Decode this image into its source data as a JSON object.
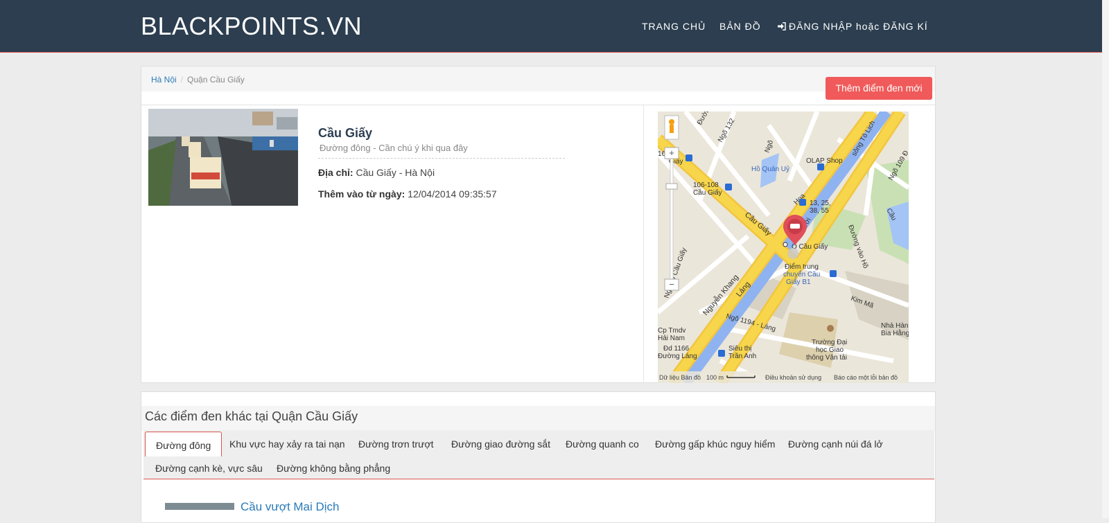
{
  "nav": {
    "brand": "BLACKPOINTS.VN",
    "home": "TRANG CHỦ",
    "map": "BẢN ĐỒ",
    "login": "ĐĂNG NHẬP hoặc ĐĂNG KÍ"
  },
  "breadcrumb": {
    "city": "Hà Nội",
    "district": "Quận Cầu Giấy"
  },
  "add_button": "Thêm điểm đen mới",
  "point": {
    "title": "Cầu Giấy",
    "subtitle": "Đường đông - Cần chú ý khi qua đây",
    "address_label": "Địa chỉ:",
    "address": "Cầu Giấy - Hà Nội",
    "added_label": "Thêm vào từ ngày:",
    "added": "12/04/2014 09:35:57"
  },
  "map": {
    "labels": {
      "l1": "Hồ Quản Uỷ",
      "l2": "OLAP Shop",
      "l3": "106-108",
      "l4": "Cầu Giấy",
      "l5": "13, 25,",
      "l6": "38, 55",
      "l7": "Ô Cầu Giấy",
      "l8": "Điểm trung",
      "l9": "chuyển Cầu",
      "l10": "Giấy B1",
      "l11": "Kim Mã",
      "l12": "Nhà Hàng",
      "l13": "Bia Hằng",
      "l14": "Trường Đại",
      "l15": "học Giao",
      "l16": "thông Vận tải",
      "l17": "Siêu thị",
      "l18": "Trần Anh",
      "l19": "Cp Tmdv",
      "l20": "Hải Nam",
      "l21": "Đd 1166",
      "l22": "Đường Láng",
      "l23": "Ngõ 132",
      "l24": "Ngõ",
      "l25": "Cầu Giấy",
      "l26": "Nguyễn Khang",
      "l27": "Láng",
      "l28": "Ngõ 1194 - Láng",
      "l29": "Ngõ 79 Cầu Giấy",
      "l30": "Bưởi",
      "l31": "Hoa",
      "l32": "sông Tô Lịch",
      "l33": "Ngõ 109 Đ",
      "l34": "Đường vào Hồ",
      "l35": "Cầu",
      "l36": "Giấy",
      "l37": "Đường",
      "l38": "165"
    },
    "footer_data": "Dữ liệu Bản đồ",
    "footer_scale": "100 m",
    "footer_terms": "Điều khoản sử dụng",
    "footer_report": "Báo cáo một lỗi bản đồ",
    "zoom_in": "+",
    "zoom_out": "−"
  },
  "others": {
    "title": "Các điểm đen khác tại Quận Cầu Giấy",
    "tabs": [
      "Đường đông",
      "Khu vực hay xảy ra tai nạn",
      "Đường trơn trượt",
      "Đường giao đường sắt",
      "Đường quanh co",
      "Đường gấp khúc nguy hiểm",
      "Đường cạnh núi đá lở",
      "Đường cạnh kè, vực sâu",
      "Đường không bằng phẳng"
    ],
    "first_item": "Cầu vượt Mai Dịch"
  },
  "colors": {
    "navbar": "#2c3e50",
    "accent": "#d9534f",
    "button": "#f05a5a",
    "link": "#2a7ab8",
    "road": "#f7d64c",
    "marker": "#e04e5a"
  }
}
